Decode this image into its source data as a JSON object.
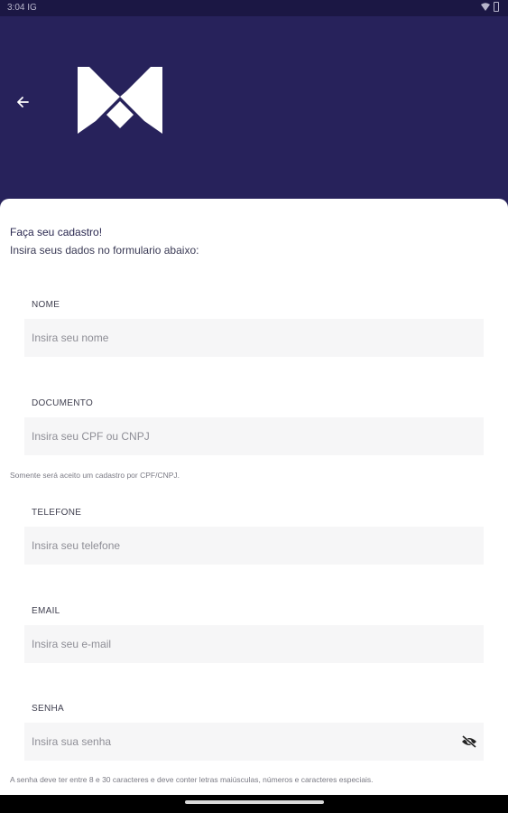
{
  "status_bar": {
    "time": "3:04 IG"
  },
  "header": {
    "back_icon": "arrow-left-icon",
    "logo_icon": "brand-logo"
  },
  "form": {
    "title": "Faça seu cadastro!",
    "subtitle": "Insira seus dados no formulario abaixo:",
    "fields": {
      "nome": {
        "label": "NOME",
        "placeholder": "Insira seu nome"
      },
      "documento": {
        "label": "DOCUMENTO",
        "placeholder": "Insira seu CPF ou CNPJ",
        "hint": "Somente será aceito um cadastro por CPF/CNPJ."
      },
      "telefone": {
        "label": "TELEFONE",
        "placeholder": "Insira seu telefone"
      },
      "email": {
        "label": "EMAIL",
        "placeholder": "Insira seu e-mail"
      },
      "senha": {
        "label": "SENHA",
        "placeholder": "Insira sua senha",
        "hint": "A senha deve ter entre 8 e 30 caracteres e deve conter letras maiúsculas, números e caracteres especiais.",
        "toggle_icon": "eye-off-icon"
      }
    }
  },
  "colors": {
    "header_bg": "#27225b",
    "card_bg": "#ffffff",
    "input_bg": "#f6f6f7"
  }
}
